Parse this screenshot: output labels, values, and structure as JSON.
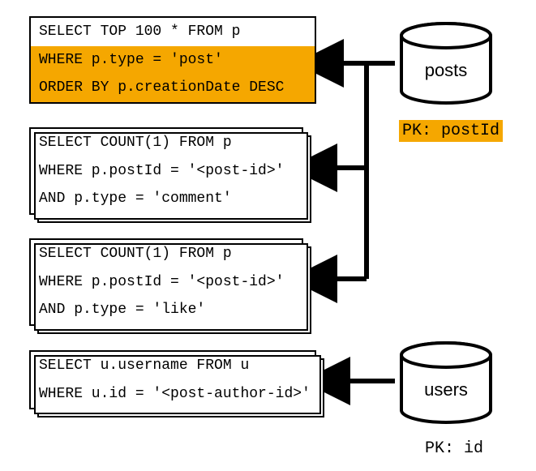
{
  "queries": {
    "q1": {
      "line1": "SELECT TOP 100 * FROM p",
      "line2": "WHERE p.type = 'post'",
      "line3": "ORDER BY p.creationDate DESC"
    },
    "q2": {
      "line1": "SELECT COUNT(1) FROM p",
      "line2": "WHERE p.postId = '<post-id>'",
      "line3": "AND p.type = 'comment'"
    },
    "q3": {
      "line1": "SELECT COUNT(1) FROM p",
      "line2": "WHERE p.postId = '<post-id>'",
      "line3": "AND p.type = 'like'"
    },
    "q4": {
      "line1": "SELECT u.username FROM u",
      "line2": "WHERE u.id = '<post-author-id>'"
    }
  },
  "db": {
    "posts": {
      "name": "posts",
      "pk": "PK: postId"
    },
    "users": {
      "name": "users",
      "pk": "PK: id"
    }
  },
  "colors": {
    "highlight": "#f5a700"
  }
}
